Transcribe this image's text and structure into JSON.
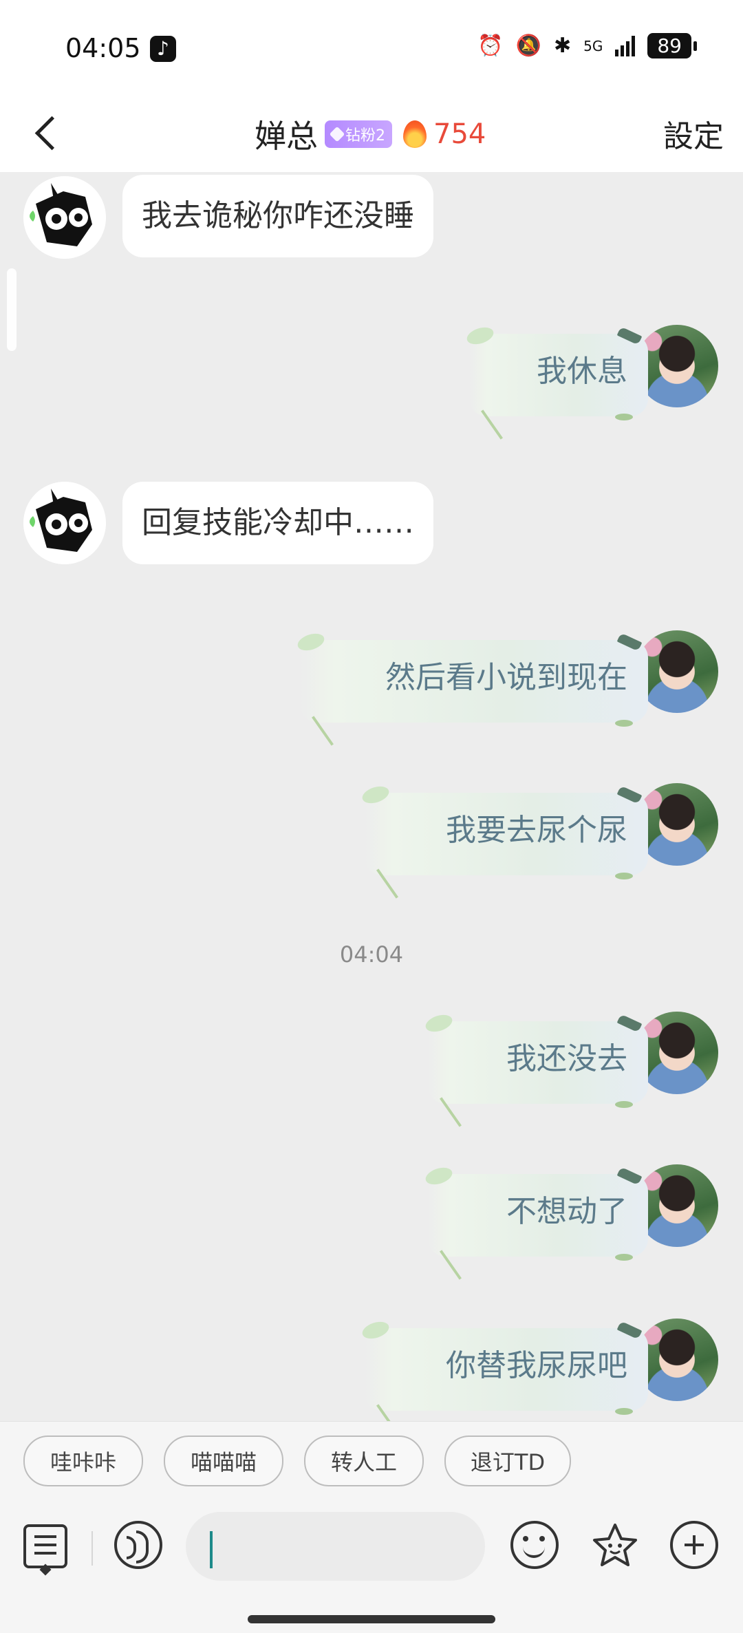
{
  "status_bar": {
    "time": "04:05",
    "network": "5G",
    "battery": "89"
  },
  "header": {
    "title": "婵总",
    "badge": "钻粉2",
    "streak": "754",
    "settings_label": "設定"
  },
  "messages": [
    {
      "side": "in",
      "text": "我去诡秘你咋还没睡"
    },
    {
      "side": "out",
      "text": "我休息"
    },
    {
      "side": "in",
      "text": "回复技能冷却中……"
    },
    {
      "side": "out",
      "text": "然后看小说到现在"
    },
    {
      "side": "out",
      "text": "我要去尿个尿"
    },
    {
      "side": "out",
      "text": "我还没去"
    },
    {
      "side": "out",
      "text": "不想动了"
    },
    {
      "side": "out",
      "text": "你替我尿尿吧"
    }
  ],
  "time_divider": "04:04",
  "quick_replies": [
    "哇咔咔",
    "喵喵喵",
    "转人工",
    "退订TD"
  ],
  "input": {
    "value": "",
    "placeholder": ""
  },
  "icons": [
    "back-icon",
    "tiktok-icon",
    "alarm-icon",
    "mute-bell-icon",
    "bluetooth-icon",
    "signal-icon",
    "battery-icon",
    "diamond-icon",
    "flame-icon",
    "message-list-icon",
    "voice-icon",
    "emoji-icon",
    "sticker-icon",
    "plus-icon"
  ],
  "colors": {
    "streak": "#e84a3a",
    "out_text": "#5b7a8a",
    "background": "#ededed"
  }
}
